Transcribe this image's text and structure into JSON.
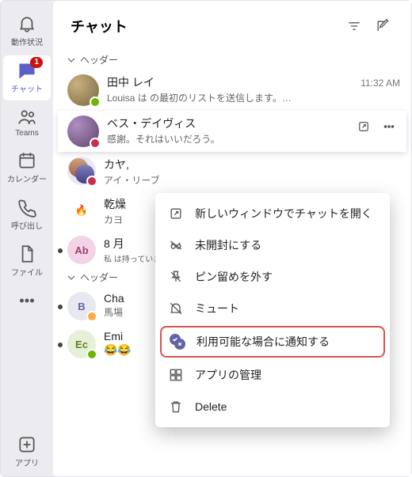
{
  "rail": {
    "activity": "動作状況",
    "chat": "チャット",
    "teams": "Teams",
    "calendar": "カレンダー",
    "calls": "呼び出し",
    "files": "ファイル",
    "apps": "アプリ",
    "chat_badge": "1"
  },
  "header": {
    "title": "チャット"
  },
  "section1": "ヘッダー",
  "section2": "ヘッダー",
  "items": [
    {
      "name": "田中 レイ",
      "time": "11:32 AM",
      "preview": "Louisa は の最初のリストを送信します。…"
    },
    {
      "name": "ベス・デイヴィス",
      "preview": "感謝。それはいいだろう。"
    },
    {
      "name": "カヤ,",
      "preview": "アイ・リーブ"
    },
    {
      "name": "乾燥",
      "preview": "カヨ"
    },
    {
      "name": "8 月",
      "preview": "私 は持っています",
      "initials": "Ab"
    },
    {
      "name": "Cha",
      "preview": "馬場",
      "initials": "B"
    },
    {
      "name": "Emi",
      "preview": "😂😂",
      "initials": "Ec"
    }
  ],
  "menu": {
    "open_new_window": "新しいウィンドウでチャットを開く",
    "mark_unread": "未開封にする",
    "unpin": "ピン留めを外す",
    "mute": "ミュート",
    "notify_available": "利用可能な場合に通知する",
    "manage_apps": "アプリの管理",
    "delete": "Delete"
  }
}
